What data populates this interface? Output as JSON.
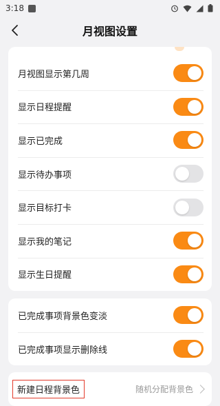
{
  "status": {
    "time": "3:18"
  },
  "header": {
    "title": "月视图设置"
  },
  "group1": [
    {
      "label": "月视图显示第几周",
      "on": true
    },
    {
      "label": "显示日程提醒",
      "on": true
    },
    {
      "label": "显示已完成",
      "on": true
    },
    {
      "label": "显示待办事项",
      "on": false
    },
    {
      "label": "显示目标打卡",
      "on": false
    },
    {
      "label": "显示我的笔记",
      "on": true
    },
    {
      "label": "显示生日提醒",
      "on": true
    }
  ],
  "group2": [
    {
      "label": "已完成事项背景色变淡",
      "on": true
    },
    {
      "label": "已完成事项显示删除线",
      "on": true
    }
  ],
  "group3": {
    "label": "新建日程背景色",
    "value": "随机分配背景色"
  },
  "colors": {
    "accent": "#fa8a14",
    "toggle_off": "#e3e3e5",
    "highlight_border": "#e33a2a"
  }
}
